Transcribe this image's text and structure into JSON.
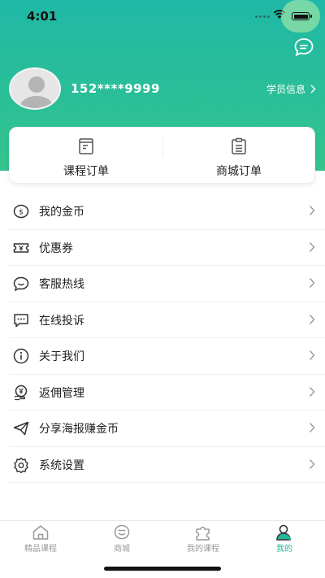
{
  "status": {
    "time": "4:01"
  },
  "user": {
    "phone": "152****9999",
    "info_link": "学员信息"
  },
  "orders": [
    {
      "label": "课程订单",
      "icon": "course-order-icon"
    },
    {
      "label": "商城订单",
      "icon": "mall-order-icon"
    }
  ],
  "menu": [
    {
      "label": "我的金币",
      "icon": "coin-icon"
    },
    {
      "label": "优惠券",
      "icon": "coupon-icon"
    },
    {
      "label": "客服热线",
      "icon": "chat-bubble-icon"
    },
    {
      "label": "在线投诉",
      "icon": "complaint-icon"
    },
    {
      "label": "关于我们",
      "icon": "info-icon"
    },
    {
      "label": "返佣管理",
      "icon": "commission-icon"
    },
    {
      "label": "分享海报赚金币",
      "icon": "share-send-icon"
    },
    {
      "label": "系统设置",
      "icon": "settings-gear-icon"
    }
  ],
  "tabs": [
    {
      "label": "精品课程",
      "icon": "home-icon",
      "active": false
    },
    {
      "label": "商城",
      "icon": "smile-mall-icon",
      "active": false
    },
    {
      "label": "我的课程",
      "icon": "puzzle-icon",
      "active": false
    },
    {
      "label": "我的",
      "icon": "profile-icon",
      "active": true
    }
  ],
  "colors": {
    "header_top": "#1fb8a6",
    "header_bottom": "#34c48c",
    "accent": "#1fb89a",
    "inactive": "#999999"
  }
}
